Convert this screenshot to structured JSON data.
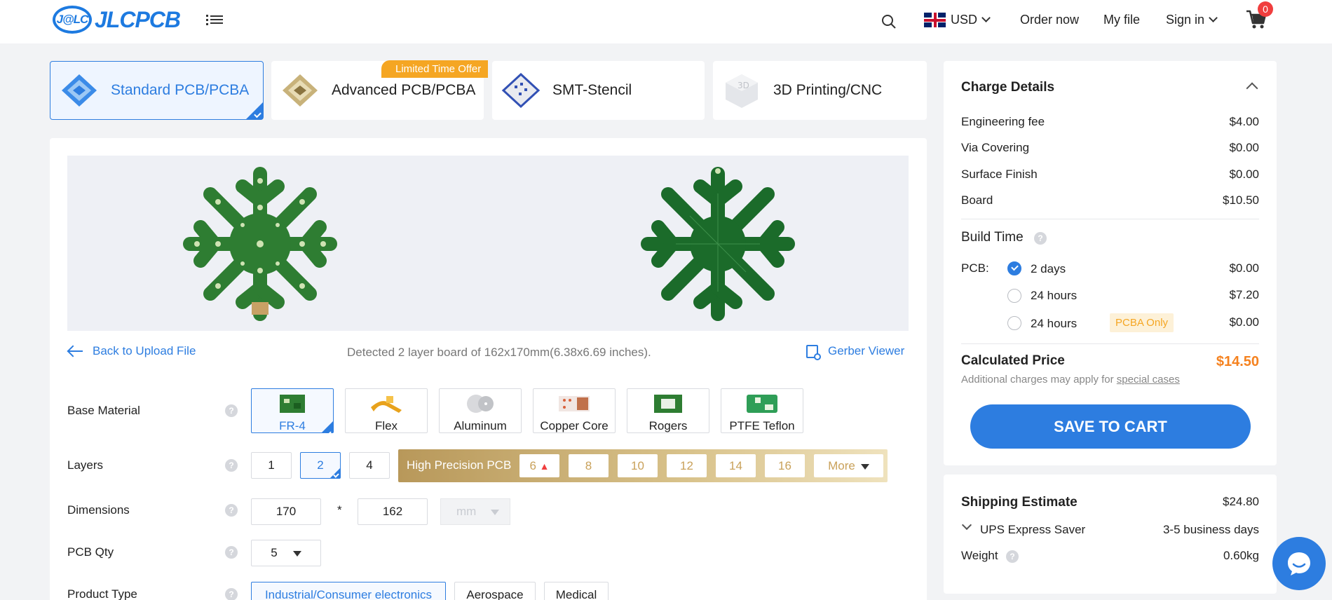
{
  "header": {
    "logo_badge": "J@LC",
    "logo_text": "JLCPCB",
    "currency": "USD",
    "order_now": "Order now",
    "my_file": "My file",
    "sign_in": "Sign in",
    "cart_count": "0"
  },
  "tabs": [
    {
      "label": "Standard PCB/PCBA",
      "active": true
    },
    {
      "label": "Advanced PCB/PCBA",
      "badge": "Limited Time Offer"
    },
    {
      "label": "SMT-Stencil"
    },
    {
      "label": "3D Printing/CNC"
    }
  ],
  "preview": {
    "back_label": "Back to Upload File",
    "detected_text": "Detected 2 layer board of 162x170mm(6.38x6.69 inches).",
    "gerber_label": "Gerber Viewer"
  },
  "form": {
    "base_material": {
      "label": "Base Material",
      "options": [
        "FR-4",
        "Flex",
        "Aluminum",
        "Copper Core",
        "Rogers",
        "PTFE Teflon"
      ],
      "selected": "FR-4"
    },
    "layers": {
      "label": "Layers",
      "options": [
        "1",
        "2",
        "4"
      ],
      "selected": "2",
      "hp_label": "High Precision PCB",
      "hp_options": [
        "6",
        "8",
        "10",
        "12",
        "14",
        "16"
      ],
      "more": "More"
    },
    "dimensions": {
      "label": "Dimensions",
      "width": "170",
      "sep": "*",
      "height": "162",
      "unit": "mm"
    },
    "qty": {
      "label": "PCB Qty",
      "value": "5"
    },
    "product_type": {
      "label": "Product Type",
      "options": [
        "Industrial/Consumer electronics",
        "Aerospace",
        "Medical"
      ],
      "selected": "Industrial/Consumer electronics"
    }
  },
  "charges": {
    "title": "Charge Details",
    "items": [
      {
        "label": "Engineering fee",
        "value": "$4.00"
      },
      {
        "label": "Via Covering",
        "value": "$0.00"
      },
      {
        "label": "Surface Finish",
        "value": "$0.00"
      },
      {
        "label": "Board",
        "value": "$10.50"
      }
    ],
    "build_time_title": "Build Time",
    "pcb_label": "PCB:",
    "build_options": [
      {
        "label": "2 days",
        "value": "$0.00",
        "selected": true
      },
      {
        "label": "24 hours",
        "value": "$7.20"
      },
      {
        "label": "24 hours",
        "value": "$0.00",
        "badge": "PCBA Only"
      }
    ],
    "calc_title": "Calculated Price",
    "calc_value": "$14.50",
    "note_prefix": "Additional charges may apply for ",
    "note_link": "special cases",
    "save_label": "SAVE TO CART"
  },
  "shipping": {
    "title": "Shipping Estimate",
    "value": "$24.80",
    "method": "UPS Express Saver",
    "days": "3-5 business days",
    "weight_label": "Weight",
    "weight_value": "0.60kg"
  },
  "colors": {
    "accent": "#2d7de0",
    "price": "#f5821f",
    "offer": "#f5a623",
    "hp_gold": "#c9a15a"
  }
}
